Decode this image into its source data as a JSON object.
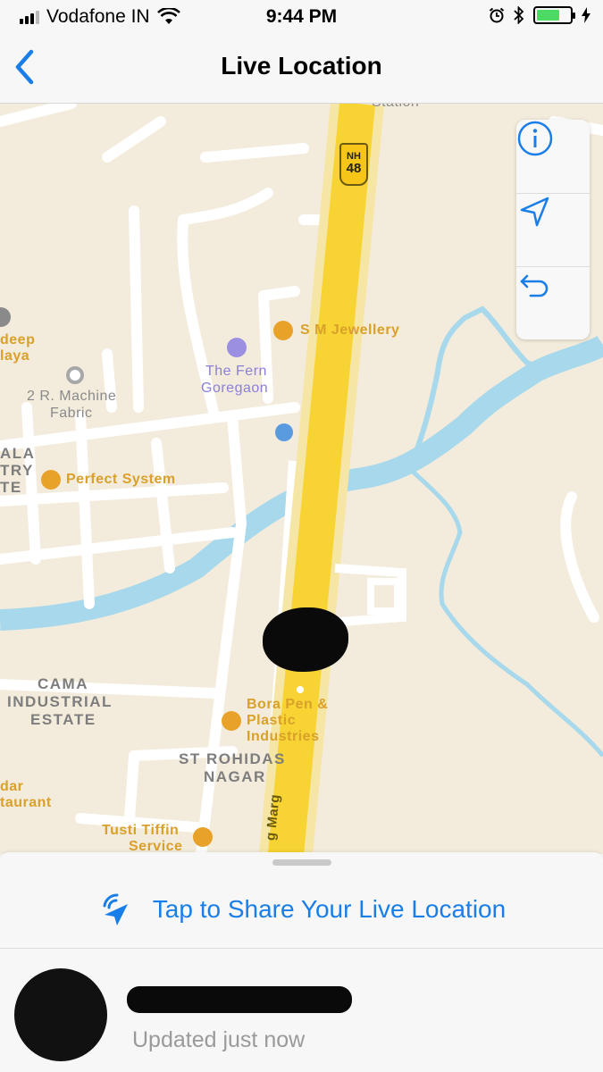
{
  "status_bar": {
    "carrier": "Vodafone IN",
    "time": "9:44 PM",
    "battery_percent": 70
  },
  "nav": {
    "title": "Live Location",
    "back_icon": "chevron-left-icon"
  },
  "map": {
    "highway_shield_top": "NH",
    "highway_shield_number": "48",
    "road_label": "g Marg",
    "pois": {
      "sm_jewellery": "S M Jewellery",
      "the_fern_line1": "The Fern",
      "the_fern_line2": "Goregaon",
      "machine_line1": "2 R. Machine",
      "machine_line2": "Fabric",
      "perfect_system": "Perfect System",
      "bora_line1": "Bora Pen &",
      "bora_line2": "Plastic",
      "bora_line3": "Industries",
      "tusti_line1": "Tusti Tiffin",
      "tusti_line2": "Service",
      "deep_line1": "deep",
      "deep_line2": "laya",
      "dar_line1": "dar",
      "dar_line2": "taurant",
      "station": "Station"
    },
    "areas": {
      "cama_line1": "CAMA",
      "cama_line2": "INDUSTRIAL",
      "cama_line3": "ESTATE",
      "rohidas_line1": "ST ROHIDAS",
      "rohidas_line2": "NAGAR",
      "ala_line1": "ALA",
      "ala_line2": "TRY",
      "ala_line3": "TE"
    },
    "controls": [
      "info-icon",
      "location-arrow-icon",
      "back-return-icon"
    ]
  },
  "sheet": {
    "share_label": "Tap to Share Your Live Location",
    "updated_text": "Updated just now"
  },
  "colors": {
    "accent": "#1a7ee8",
    "highway": "#f7d433",
    "water": "#a7d8ec",
    "map_bg": "#f3ecdc"
  }
}
